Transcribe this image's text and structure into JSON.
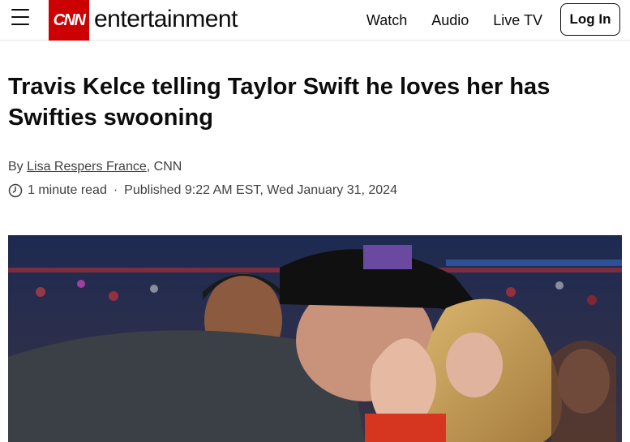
{
  "header": {
    "logo": "CNN",
    "section": "entertainment",
    "nav": [
      "Watch",
      "Audio",
      "Live TV"
    ],
    "login": "Log In"
  },
  "article": {
    "headline": "Travis Kelce telling Taylor Swift he loves her has Swifties swooning",
    "by_prefix": "By ",
    "author": "Lisa Respers France",
    "outlet": ", CNN",
    "read_time": "1 minute read",
    "separator": "·",
    "published": "Published 9:22 AM EST, Wed January 31, 2024"
  },
  "colors": {
    "brand": "#cc0000",
    "text": "#0c0c0c",
    "meta": "#404040"
  },
  "icons": [
    "menu-icon",
    "clock-icon"
  ]
}
